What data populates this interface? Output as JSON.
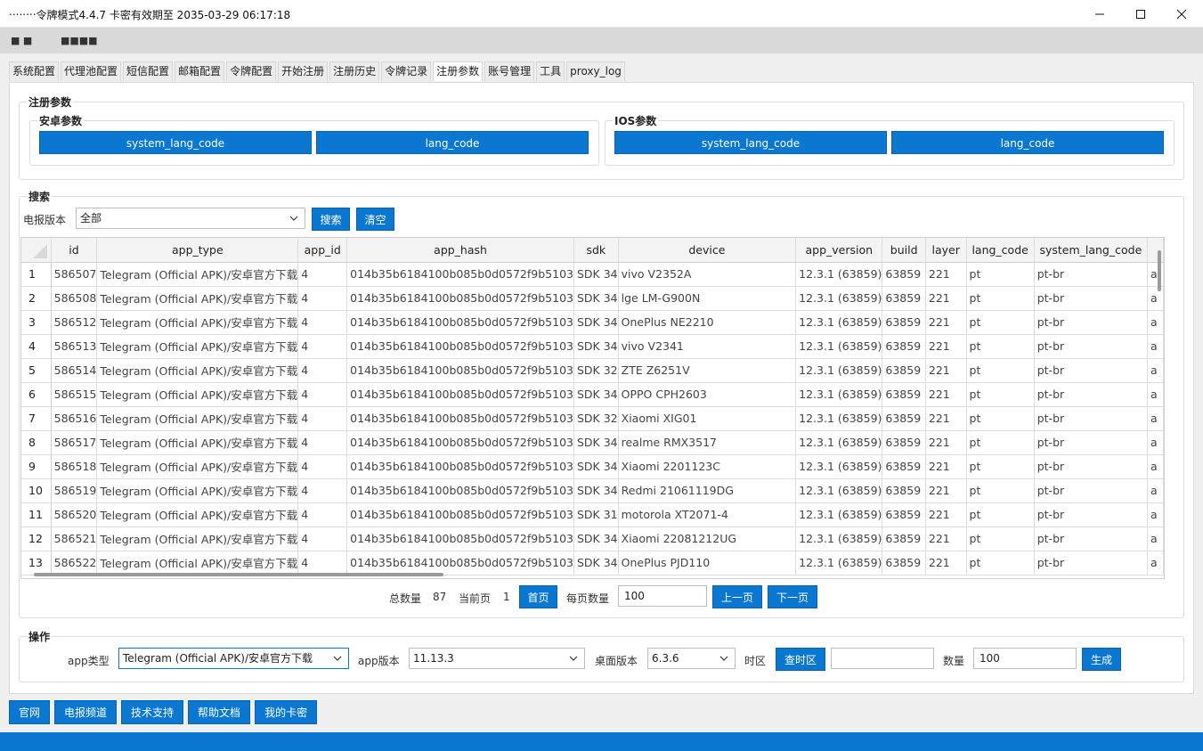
{
  "window": {
    "title": "‧‧‧‧‧‧‧‧令牌模式4.4.7 卡密有效期至 2035-03-29 06:17:18"
  },
  "menu": [
    "■ ■",
    "■■■■"
  ],
  "tabs": [
    "系统配置",
    "代理池配置",
    "短信配置",
    "邮箱配置",
    "令牌配置",
    "开始注册",
    "注册历史",
    "令牌记录",
    "注册参数",
    "账号管理",
    "工具",
    "proxy_log"
  ],
  "active_tab": "注册参数",
  "reg_params": {
    "title": "注册参数",
    "android": {
      "title": "安卓参数",
      "btn1": "system_lang_code",
      "btn2": "lang_code"
    },
    "ios": {
      "title": "IOS参数",
      "btn1": "system_lang_code",
      "btn2": "lang_code"
    }
  },
  "search": {
    "title": "搜索",
    "version_label": "电报版本",
    "version_value": "全部",
    "search_btn": "搜索",
    "clear_btn": "清空"
  },
  "table": {
    "columns": [
      "id",
      "app_type",
      "app_id",
      "app_hash",
      "sdk",
      "device",
      "app_version",
      "build",
      "layer",
      "lang_code",
      "system_lang_code",
      ""
    ],
    "rows": [
      [
        "1",
        "586507",
        "Telegram (Official APK)/安卓官方下载",
        "4",
        "014b35b6184100b085b0d0572f9b5103",
        "SDK 34",
        "vivo V2352A",
        "12.3.1 (63859)",
        "63859",
        "221",
        "pt",
        "pt-br",
        "a"
      ],
      [
        "2",
        "586508",
        "Telegram (Official APK)/安卓官方下载",
        "4",
        "014b35b6184100b085b0d0572f9b5103",
        "SDK 34",
        "lge LM-G900N",
        "12.3.1 (63859)",
        "63859",
        "221",
        "pt",
        "pt-br",
        "a"
      ],
      [
        "3",
        "586512",
        "Telegram (Official APK)/安卓官方下载",
        "4",
        "014b35b6184100b085b0d0572f9b5103",
        "SDK 34",
        "OnePlus NE2210",
        "12.3.1 (63859)",
        "63859",
        "221",
        "pt",
        "pt-br",
        "a"
      ],
      [
        "4",
        "586513",
        "Telegram (Official APK)/安卓官方下载",
        "4",
        "014b35b6184100b085b0d0572f9b5103",
        "SDK 34",
        "vivo V2341",
        "12.3.1 (63859)",
        "63859",
        "221",
        "pt",
        "pt-br",
        "a"
      ],
      [
        "5",
        "586514",
        "Telegram (Official APK)/安卓官方下载",
        "4",
        "014b35b6184100b085b0d0572f9b5103",
        "SDK 32",
        "ZTE Z6251V",
        "12.3.1 (63859)",
        "63859",
        "221",
        "pt",
        "pt-br",
        "a"
      ],
      [
        "6",
        "586515",
        "Telegram (Official APK)/安卓官方下载",
        "4",
        "014b35b6184100b085b0d0572f9b5103",
        "SDK 34",
        "OPPO CPH2603",
        "12.3.1 (63859)",
        "63859",
        "221",
        "pt",
        "pt-br",
        "a"
      ],
      [
        "7",
        "586516",
        "Telegram (Official APK)/安卓官方下载",
        "4",
        "014b35b6184100b085b0d0572f9b5103",
        "SDK 32",
        "Xiaomi XIG01",
        "12.3.1 (63859)",
        "63859",
        "221",
        "pt",
        "pt-br",
        "a"
      ],
      [
        "8",
        "586517",
        "Telegram (Official APK)/安卓官方下载",
        "4",
        "014b35b6184100b085b0d0572f9b5103",
        "SDK 34",
        "realme RMX3517",
        "12.3.1 (63859)",
        "63859",
        "221",
        "pt",
        "pt-br",
        "a"
      ],
      [
        "9",
        "586518",
        "Telegram (Official APK)/安卓官方下载",
        "4",
        "014b35b6184100b085b0d0572f9b5103",
        "SDK 34",
        "Xiaomi 2201123C",
        "12.3.1 (63859)",
        "63859",
        "221",
        "pt",
        "pt-br",
        "a"
      ],
      [
        "10",
        "586519",
        "Telegram (Official APK)/安卓官方下载",
        "4",
        "014b35b6184100b085b0d0572f9b5103",
        "SDK 34",
        "Redmi 21061119DG",
        "12.3.1 (63859)",
        "63859",
        "221",
        "pt",
        "pt-br",
        "a"
      ],
      [
        "11",
        "586520",
        "Telegram (Official APK)/安卓官方下载",
        "4",
        "014b35b6184100b085b0d0572f9b5103",
        "SDK 31",
        "motorola XT2071-4",
        "12.3.1 (63859)",
        "63859",
        "221",
        "pt",
        "pt-br",
        "a"
      ],
      [
        "12",
        "586521",
        "Telegram (Official APK)/安卓官方下载",
        "4",
        "014b35b6184100b085b0d0572f9b5103",
        "SDK 34",
        "Xiaomi 22081212UG",
        "12.3.1 (63859)",
        "63859",
        "221",
        "pt",
        "pt-br",
        "a"
      ],
      [
        "13",
        "586522",
        "Telegram (Official APK)/安卓官方下载",
        "4",
        "014b35b6184100b085b0d0572f9b5103",
        "SDK 34",
        "OnePlus PJD110",
        "12.3.1 (63859)",
        "63859",
        "221",
        "pt",
        "pt-br",
        "a"
      ]
    ]
  },
  "pagination": {
    "total_label": "总数量",
    "total": "87",
    "current_label": "当前页",
    "current": "1",
    "first_btn": "首页",
    "per_page_label": "每页数量",
    "per_page": "100",
    "prev_btn": "上一页",
    "next_btn": "下一页"
  },
  "ops": {
    "title": "操作",
    "app_type_label": "app类型",
    "app_type_value": "Telegram (Official APK)/安卓官方下载",
    "app_version_label": "app版本",
    "app_version_value": "11.13.3",
    "desktop_version_label": "桌面版本",
    "desktop_version_value": "6.3.6",
    "timezone_label": "时区",
    "check_tz_btn": "查时区",
    "timezone_value": "",
    "count_label": "数量",
    "count_value": "100",
    "generate_btn": "生成"
  },
  "bottom_buttons": [
    "官网",
    "电报频道",
    "技术支持",
    "帮助文档",
    "我的卡密"
  ],
  "colors": {
    "accent": "#0a78d1",
    "statusbar": "#0a78d1"
  }
}
